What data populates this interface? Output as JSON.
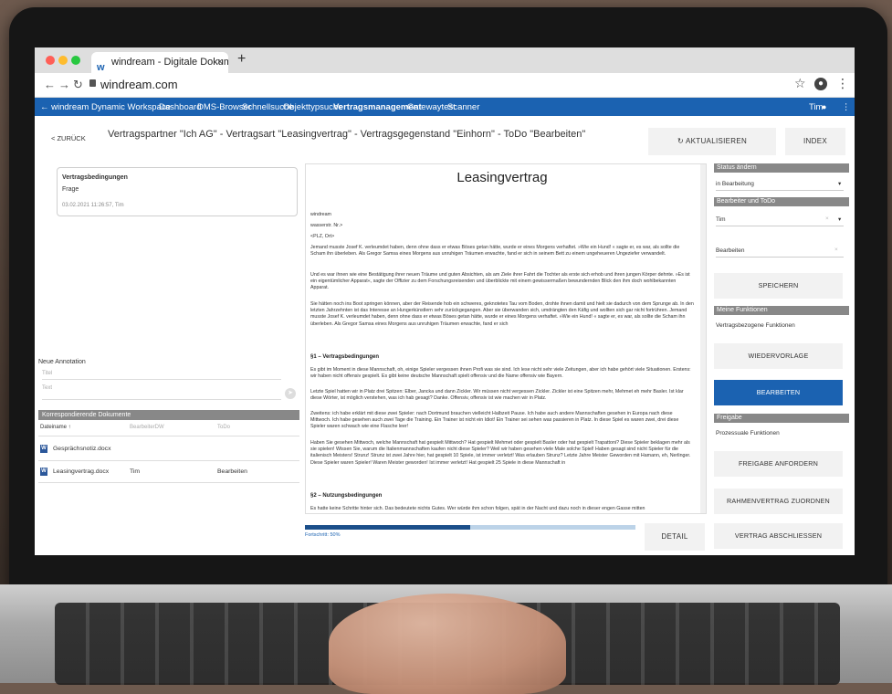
{
  "browser": {
    "tab_title": "windream - Digitale Dokument",
    "tab_close": "×",
    "new_tab": "+",
    "url": "windream.com"
  },
  "appbar": {
    "brand": "← windream Dynamic Workspace",
    "nav": [
      "Dashboard",
      "DMS-Browser",
      "Schnellsuche",
      "Objekttypsuche",
      "Vertragsmanagement",
      "Gatewaytest",
      "Scanner"
    ],
    "active_index": 4,
    "user": "Tim"
  },
  "header": {
    "back_label": "< ZURÜCK",
    "title": "Vertragspartner \"Ich AG\" - Vertragsart \"Leasingvertrag\" - Vertragsgegenstand \"Einhorn\" - ToDo \"Bearbeiten\"",
    "refresh_label": "↻ AKTUALISIEREN",
    "index_label": "INDEX"
  },
  "left": {
    "card": {
      "title": "Vertragsbedingungen",
      "subtitle": "Frage",
      "meta": "03.02.2021 11:26:57, Tim"
    },
    "annotation": {
      "label": "Neue Annotation",
      "title_ph": "Titel",
      "text_ph": "Text"
    },
    "docs": {
      "label": "Korrespondierende Dokumente",
      "columns": [
        "Dateiname ↑",
        "BearbeiterDW",
        "ToDo"
      ],
      "rows": [
        {
          "name": "Gesprächsnotiz.docx",
          "editor": "",
          "todo": ""
        },
        {
          "name": "Leasingvertrag.docx",
          "editor": "Tim",
          "todo": "Bearbeiten"
        }
      ]
    }
  },
  "document": {
    "title": "Leasingvertrag",
    "address": [
      "windream",
      "wasserstr. Nr.>",
      "<PLZ, Ort>"
    ],
    "para1": "Jemand musste Josef K. verleumdet haben, denn ohne dass er etwas Böses getan hätte, wurde er eines Morgens verhaftet. »Wie ein Hund! « sagte er, es war, als sollte die Scham ihn überleben. Als Gregor Samsa eines Morgens aus unruhigen Träumen erwachte, fand er sich in seinem Bett zu einem ungeheueren Ungeziefer verwandelt.",
    "para2": "Und es war ihnen wie eine Bestätigung ihrer neuen Träume und guten Absichten, als am Ziele ihrer Fahrt die Tochter als erste sich erhob und ihren jungen Körper dehnte. »Es ist ein eigentümlicher Apparat«, sagte der Offizier zu dem Forschungsreisenden und überblickte mit einem gewissermaßen bewundernden Blick den ihm doch wohlbekannten Apparat.",
    "para3": "Sie hätten noch ins Boot springen können, aber der Reisende hob ein schweres, geknotetes Tau vom Boden, drohte ihnen damit und hielt sie dadurch von dem Sprunge ab. In den letzten Jahrzehnten ist das Interesse an Hungerkünstlern sehr zurückgegangen. Aber sie überwanden sich, umdrängten den Käfig und wollten sich gar nicht fortrühren. Jemand musste Josef K. verleumdet haben, denn ohne dass er etwas Böses getan hätte, wurde er eines Morgens verhaftet. »Wie ein Hund! « sagte er, es war, als sollte die Scham ihn überleben. Als Gregor Samsa eines Morgens aus unruhigen Träumen erwachte, fand er sich",
    "h1": "§1 – Vertragsbedingungen",
    "para4": "Es gibt im Moment in diese Mannschaft, oh, einige Spieler vergessen ihnen Profi was sie sind. Ich lese nicht sehr viele Zeitungen, aber ich habe gehört viele Situationen. Erstens: wir haben nicht offensiv gespielt. Es gibt keine deutsche Mannschaft spielt offensiv und die Name offensiv wie Bayern.",
    "para5": "Letzte Spiel hatten wir in Platz drei Spitzen: Elber, Jancka und dann Zickler. Wir müssen nicht vergessen Zickler. Zickler ist eine Spitzen mehr, Mehmet eh mehr Basler. Ist klar diese Wörter, ist möglich verstehen, was ich hab gesagt? Danke. Offensiv, offensiv ist wie machen wir in Platz.",
    "para6": "Zweitens: ich habe erklärt mit diese zwei Spieler: nach Dortmund brauchen vielleicht Halbzeit Pause. Ich habe auch andere Mannschaften gesehen in Europa nach diese Mittwoch. Ich habe gesehen auch zwei Tage die Training. Ein Trainer ist nicht ein Idiot! Ein Trainer sei sehen was passieren in Platz. In diese Spiel es waren zwei, drei diese Spieler waren schwach wie eine Flasche leer!",
    "para7": "Haben Sie gesehen Mittwoch, welche Mannschaft hat gespielt Mittwoch? Hat gespielt Mehmet oder gespielt Basler oder hat gespielt Trapattoni? Diese Spieler beklagen mehr als sie spielen! Wissen Sie, warum die Italienmannschaften kaufen nicht diese Spieler? Weil wir haben gesehen viele Male solche Spiel! Haben gesagt sind nicht Spieler für die italienisch Meisters! Strunz! Strunz ist zwei Jahre hier, hat gespielt 10 Spiele, ist immer verletzt! Was erlauben Strunz? Letzte Jahre Meister Geworden mit Hamann, eh, Nerlinger. Diese Spieler waren Spieler! Waren Meister geworden! Ist immer verletzt! Hat gespielt 25 Spiele in diese Mannschaft in",
    "h2": "§2 – Nutzungsbedingungen",
    "para8": "Es hatte keine Schritte hinter sich. Das bedeutete nichts Gutes. Wer würde ihm schon folgen, spät in der Nacht und dazu noch in dieser engen Gasse mitten",
    "progress_label": "Fortschritt: 50%",
    "progress": 0.5
  },
  "right": {
    "status_label": "Status ändern",
    "status_value": "in Bearbeitung",
    "editor_label": "Bearbeiter und ToDo",
    "editor_value": "Tim",
    "todo_value": "Bearbeiten",
    "save_label": "SPEICHERN",
    "functions_label": "Meine Funktionen",
    "functions_sub": "Vertragsbezogene Funktionen",
    "resubmit_label": "WIEDERVORLAGE",
    "edit_label": "BEARBEITEN",
    "release_label": "Freigabe",
    "release_sub": "Prozessuale Funktionen",
    "request_label": "FREIGABE ANFORDERN",
    "assign_label": "RAHMENVERTRAG ZUORDNEN",
    "detail_label": "DETAIL",
    "close_label": "VERTRAG ABSCHLIESSEN"
  },
  "colors": {
    "accent": "#1b62b1",
    "section_bar": "#888888",
    "progress_fill": "#1b4f8a"
  }
}
